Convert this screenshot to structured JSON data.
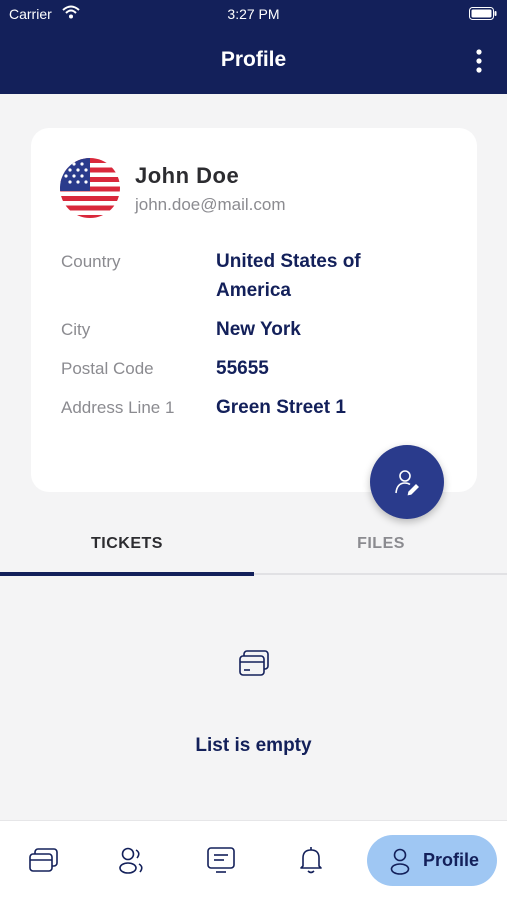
{
  "status_bar": {
    "carrier": "Carrier",
    "time": "3:27 PM"
  },
  "app_bar": {
    "title": "Profile"
  },
  "profile": {
    "name": "John  Doe",
    "email": "john.doe@mail.com",
    "fields": [
      {
        "label": "Country",
        "value": "United States of America"
      },
      {
        "label": "City",
        "value": "New York"
      },
      {
        "label": "Postal Code",
        "value": "55655"
      },
      {
        "label": "Address Line 1",
        "value": "Green Street 1"
      }
    ]
  },
  "tabs": [
    {
      "label": "TICKETS",
      "active": true
    },
    {
      "label": "FILES",
      "active": false
    }
  ],
  "empty_state": {
    "message": "List is empty",
    "icon": "cards-icon"
  },
  "bottom_nav": {
    "items": [
      {
        "icon": "cards-icon"
      },
      {
        "icon": "users-icon"
      },
      {
        "icon": "chat-icon"
      },
      {
        "icon": "bell-icon"
      },
      {
        "icon": "profile-icon",
        "label": "Profile",
        "active": true
      }
    ]
  },
  "colors": {
    "primary": "#13205a",
    "fab": "#2a3b8c",
    "active_nav": "#9fc7f3",
    "background": "#f4f4f5"
  }
}
